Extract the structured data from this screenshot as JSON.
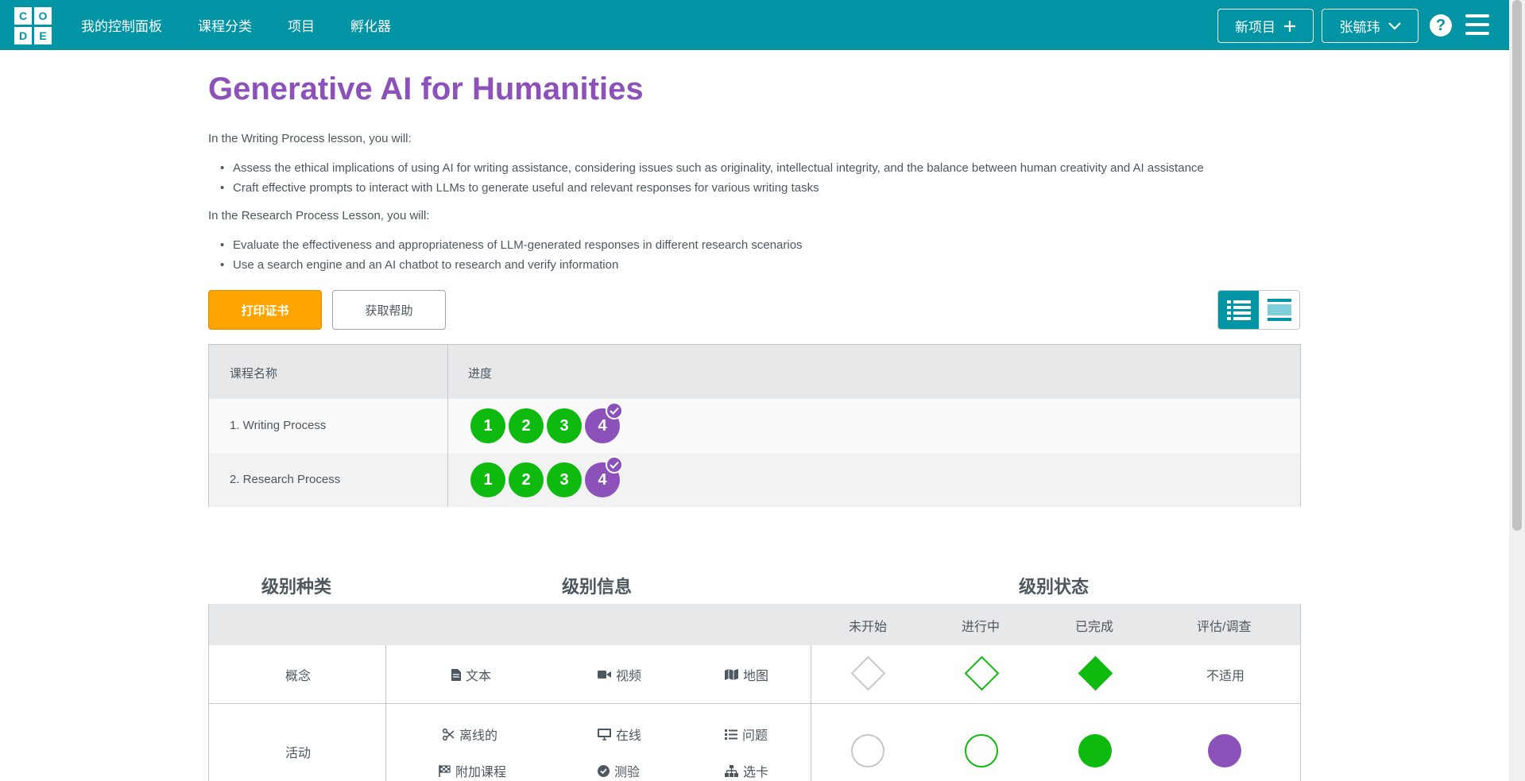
{
  "logo": {
    "letters": [
      "C",
      "O",
      "D",
      "E"
    ]
  },
  "nav": {
    "items": [
      "我的控制面板",
      "课程分类",
      "项目",
      "孵化器"
    ]
  },
  "header": {
    "new_project": "新项目",
    "user_name": "张毓玮",
    "help": "?"
  },
  "page": {
    "title": "Generative AI for Humanities",
    "intro_writing": "In the Writing Process lesson, you will:",
    "writing_points": [
      "Assess the ethical implications of using AI for writing assistance, considering issues such as originality, intellectual integrity, and the balance between human creativity and AI assistance",
      "Craft effective prompts to interact with LLMs to generate useful and relevant responses for various writing tasks"
    ],
    "intro_research": "In the Research Process Lesson, you will:",
    "research_points": [
      "Evaluate the effectiveness and appropriateness of LLM-generated responses in different research scenarios",
      "Use a search engine and an AI chatbot to research and verify information"
    ]
  },
  "actions": {
    "print_certificate": "打印证书",
    "get_help": "获取帮助"
  },
  "progress_table": {
    "col_name": "课程名称",
    "col_progress": "进度",
    "rows": [
      {
        "name": "1. Writing Process",
        "levels": [
          "1",
          "2",
          "3",
          "4"
        ]
      },
      {
        "name": "2. Research Process",
        "levels": [
          "1",
          "2",
          "3",
          "4"
        ]
      }
    ]
  },
  "key": {
    "head_type": "级别种类",
    "head_info": "级别信息",
    "head_status": "级别状态",
    "status_cols": [
      "未开始",
      "进行中",
      "已完成",
      "评估/调查"
    ],
    "concept": {
      "label": "概念",
      "items": [
        "文本",
        "视频",
        "地图"
      ],
      "assessment": "不适用"
    },
    "activity": {
      "label": "活动",
      "items": [
        "离线的",
        "在线",
        "问题",
        "附加课程",
        "测验",
        "选卡"
      ]
    }
  },
  "colors": {
    "brand": "#0094a5",
    "title": "#8c52ba",
    "complete": "#0eba0e",
    "assessment": "#8c52ba",
    "print": "#ffa400"
  }
}
